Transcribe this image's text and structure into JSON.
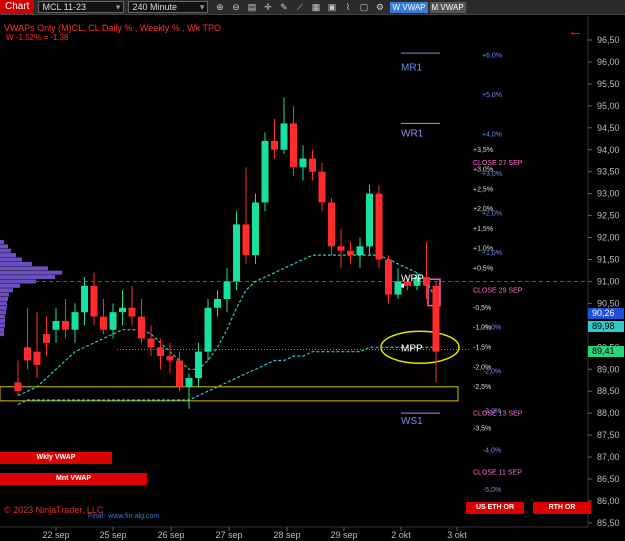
{
  "toolbar": {
    "chart_tab": "Chart",
    "instrument": "MCL 11-23",
    "timeframe": "240 Minute",
    "icons": [
      "zoom-in-icon",
      "zoom-out-icon",
      "properties-icon",
      "crosshair-icon",
      "drawing-tools-icon",
      "trend-icon",
      "templates-icon",
      "strategies-icon",
      "indicators-icon",
      "snapshot-icon",
      "settings-icon"
    ],
    "w_vwap": "W VWAP",
    "m_vwap": "M VWAP"
  },
  "header": {
    "title": "VWAPs Only (M)CL, CL Daily % , Weekly % , Wk TPO",
    "sub": "W -1,52% = -1,38"
  },
  "y_axis": [
    "96,50",
    "96,00",
    "95,50",
    "95,00",
    "94,50",
    "94,00",
    "93,50",
    "93,00",
    "92,50",
    "92,00",
    "91,50",
    "91,00",
    "90,50",
    "90,00",
    "89,50",
    "89,00",
    "88,50",
    "88,00",
    "87,50",
    "87,00",
    "86,50",
    "86,00",
    "85,50"
  ],
  "x_axis": [
    "22 sep",
    "25 sep",
    "26 sep",
    "27 sep",
    "28 sep",
    "29 sep",
    "2 okt",
    "3 okt"
  ],
  "price_boxes": [
    {
      "value": "90,26",
      "bg": "#1f4fd8",
      "fg": "#ffffff",
      "price": 90.26
    },
    {
      "value": "89,98",
      "bg": "#33c9c9",
      "fg": "#000000",
      "price": 89.98
    },
    {
      "value": "89,41",
      "bg": "#29d67a",
      "fg": "#000000",
      "price": 89.41
    }
  ],
  "levels": {
    "mr1": "MR1",
    "wr1": "WR1",
    "wpp": "WPP",
    "mpp": "MPP",
    "ws1": "WS1",
    "weekly_pct": [
      "+6,0%",
      "+5,0%",
      "+4,0%",
      "+3,0%",
      "+2,0%",
      "+1,0%",
      "-1,0%",
      "-2,0%",
      "-3,0%",
      "-4,0%",
      "-5,0%"
    ],
    "daily_pct": [
      "+3,5%",
      "+3,0%",
      "+2,5%",
      "+2,0%",
      "+1,5%",
      "+1,0%",
      "+0,5%",
      "-0,5%",
      "-1,0%",
      "-1,5%",
      "-2,0%",
      "-2,5%",
      "-3,5%"
    ],
    "closes": [
      "CLOSE 27 SEP",
      "CLOSE 29 SEP",
      "CLOSE 13 SEP",
      "CLOSE 11 SEP"
    ]
  },
  "buttons": {
    "wkly_vwap": "Wkly VWAP",
    "mnt_vwap": "Mnt VWAP",
    "us_eth_or": "US ETH OR",
    "rth_or": "RTH OR"
  },
  "footer": {
    "copyright": "© 2023 NinjaTrader, LLC",
    "final": "Final",
    "website": "- www.fin-alg.com"
  },
  "colors": {
    "up": "#18e0a0",
    "down": "#ff2a2a",
    "vwap_w": "#33c9c9",
    "tpo": "#6b4fc0",
    "level_blue": "#6f8fe8",
    "close_text": "#ff6fd0",
    "ellipse": "#e8e000"
  },
  "chart_data": {
    "type": "candlestick",
    "ylim": [
      85.3,
      96.8
    ],
    "bars": [
      {
        "o": 88.7,
        "h": 89.2,
        "l": 88.4,
        "c": 88.5
      },
      {
        "o": 89.5,
        "h": 90.4,
        "l": 89.0,
        "c": 89.2
      },
      {
        "o": 89.4,
        "h": 90.3,
        "l": 88.8,
        "c": 89.1
      },
      {
        "o": 89.8,
        "h": 90.2,
        "l": 89.3,
        "c": 89.6
      },
      {
        "o": 89.9,
        "h": 90.4,
        "l": 89.6,
        "c": 90.1
      },
      {
        "o": 90.1,
        "h": 90.6,
        "l": 89.7,
        "c": 89.9
      },
      {
        "o": 89.9,
        "h": 90.5,
        "l": 89.6,
        "c": 90.3
      },
      {
        "o": 90.3,
        "h": 91.1,
        "l": 90.0,
        "c": 90.9
      },
      {
        "o": 90.9,
        "h": 91.2,
        "l": 90.0,
        "c": 90.2
      },
      {
        "o": 90.2,
        "h": 90.6,
        "l": 89.8,
        "c": 89.9
      },
      {
        "o": 89.9,
        "h": 90.5,
        "l": 89.7,
        "c": 90.3
      },
      {
        "o": 90.3,
        "h": 90.8,
        "l": 90.0,
        "c": 90.4
      },
      {
        "o": 90.4,
        "h": 90.9,
        "l": 90.0,
        "c": 90.2
      },
      {
        "o": 90.2,
        "h": 90.6,
        "l": 89.6,
        "c": 89.7
      },
      {
        "o": 89.7,
        "h": 90.0,
        "l": 89.3,
        "c": 89.5
      },
      {
        "o": 89.5,
        "h": 89.7,
        "l": 89.0,
        "c": 89.3
      },
      {
        "o": 89.3,
        "h": 89.6,
        "l": 88.9,
        "c": 89.2
      },
      {
        "o": 89.2,
        "h": 89.4,
        "l": 88.5,
        "c": 88.6
      },
      {
        "o": 88.6,
        "h": 88.9,
        "l": 88.1,
        "c": 88.8
      },
      {
        "o": 88.8,
        "h": 89.6,
        "l": 88.6,
        "c": 89.4
      },
      {
        "o": 89.4,
        "h": 90.6,
        "l": 89.2,
        "c": 90.4
      },
      {
        "o": 90.4,
        "h": 90.8,
        "l": 90.2,
        "c": 90.6
      },
      {
        "o": 90.6,
        "h": 91.3,
        "l": 90.3,
        "c": 91.0
      },
      {
        "o": 91.0,
        "h": 92.6,
        "l": 90.8,
        "c": 92.3
      },
      {
        "o": 92.3,
        "h": 93.6,
        "l": 91.4,
        "c": 91.6
      },
      {
        "o": 91.6,
        "h": 93.0,
        "l": 91.4,
        "c": 92.8
      },
      {
        "o": 92.8,
        "h": 94.4,
        "l": 92.6,
        "c": 94.2
      },
      {
        "o": 94.2,
        "h": 94.7,
        "l": 93.8,
        "c": 94.0
      },
      {
        "o": 94.0,
        "h": 95.2,
        "l": 93.9,
        "c": 94.6
      },
      {
        "o": 94.6,
        "h": 95.0,
        "l": 93.4,
        "c": 93.6
      },
      {
        "o": 93.6,
        "h": 94.1,
        "l": 93.3,
        "c": 93.8
      },
      {
        "o": 93.8,
        "h": 94.0,
        "l": 93.3,
        "c": 93.5
      },
      {
        "o": 93.5,
        "h": 93.7,
        "l": 92.6,
        "c": 92.8
      },
      {
        "o": 92.8,
        "h": 92.9,
        "l": 91.6,
        "c": 91.8
      },
      {
        "o": 91.8,
        "h": 92.2,
        "l": 91.3,
        "c": 91.7
      },
      {
        "o": 91.7,
        "h": 91.9,
        "l": 91.4,
        "c": 91.6
      },
      {
        "o": 91.6,
        "h": 92.0,
        "l": 91.3,
        "c": 91.8
      },
      {
        "o": 91.8,
        "h": 93.2,
        "l": 91.6,
        "c": 93.0
      },
      {
        "o": 93.0,
        "h": 93.2,
        "l": 91.3,
        "c": 91.5
      },
      {
        "o": 91.5,
        "h": 91.6,
        "l": 90.5,
        "c": 90.7
      },
      {
        "o": 90.7,
        "h": 91.3,
        "l": 90.6,
        "c": 91.0
      },
      {
        "o": 91.0,
        "h": 91.1,
        "l": 90.8,
        "c": 90.9
      },
      {
        "o": 90.9,
        "h": 91.2,
        "l": 90.8,
        "c": 91.1
      },
      {
        "o": 91.1,
        "h": 91.9,
        "l": 90.6,
        "c": 90.9
      },
      {
        "o": 90.9,
        "h": 91.0,
        "l": 88.7,
        "c": 89.4
      }
    ],
    "vwap_weekly": [
      88.4,
      88.5,
      88.6,
      88.8,
      89.0,
      89.2,
      89.4,
      89.5,
      89.6,
      89.7,
      89.8,
      89.9,
      89.9,
      89.9,
      89.8,
      89.6,
      89.4,
      89.2,
      89.0,
      89.0,
      89.2,
      89.5,
      89.9,
      90.4,
      90.8,
      91.0,
      91.1,
      91.2,
      91.3,
      91.4,
      91.5,
      91.6,
      91.6,
      91.6,
      91.6,
      91.6,
      91.6,
      91.6,
      91.6,
      91.5,
      91.4,
      91.3,
      91.2,
      91.0,
      90.6
    ],
    "vwap_monthly": [
      88.2,
      88.3,
      88.3,
      88.3,
      88.3,
      88.3,
      88.3,
      88.3,
      88.3,
      88.3,
      88.3,
      88.3,
      88.3,
      88.3,
      88.3,
      88.3,
      88.3,
      88.3,
      88.3,
      88.4,
      88.5,
      88.6,
      88.7,
      88.8,
      88.9,
      89.0,
      89.1,
      89.2,
      89.2,
      89.3,
      89.3,
      89.4,
      89.4,
      89.4,
      89.4,
      89.4,
      89.4,
      89.5,
      89.5,
      89.5,
      89.5,
      89.5,
      89.5,
      89.5,
      89.5
    ]
  }
}
